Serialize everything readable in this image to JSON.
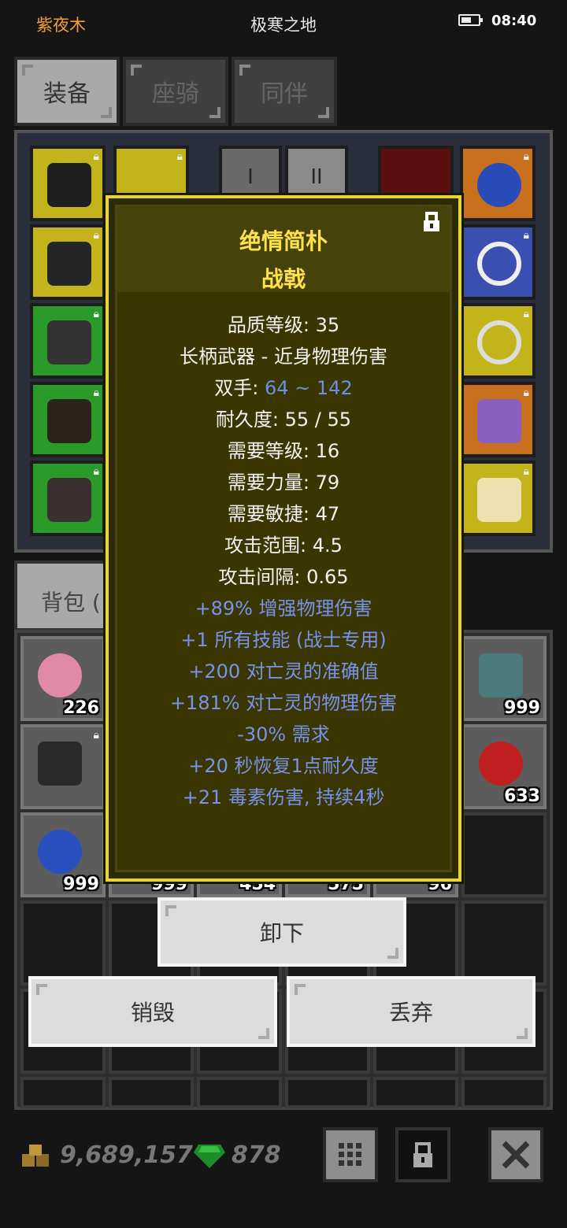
{
  "status": {
    "char_name": "紫夜木",
    "map_name": "极寒之地",
    "time": "08:40"
  },
  "tabs": [
    {
      "label": "装备"
    },
    {
      "label": "座骑"
    },
    {
      "label": "同伴"
    }
  ],
  "equip_pages": [
    "I",
    "II"
  ],
  "bag_tab": {
    "label": "背包 ("
  },
  "item": {
    "name": "绝情简朴",
    "type": "战戟",
    "lines": [
      {
        "text": "品质等级: 35",
        "style": "white"
      },
      {
        "text": "长柄武器 - 近身物理伤害",
        "style": "white"
      },
      {
        "label": "双手: ",
        "value": "64 ~ 142",
        "style": "mixed"
      },
      {
        "text": "耐久度: 55 / 55",
        "style": "white"
      },
      {
        "text": "需要等级: 16",
        "style": "white"
      },
      {
        "text": "需要力量: 79",
        "style": "white"
      },
      {
        "text": "需要敏捷: 47",
        "style": "white"
      },
      {
        "text": "攻击范围: 4.5",
        "style": "white"
      },
      {
        "text": "攻击间隔: 0.65",
        "style": "white"
      },
      {
        "text": "+89% 增强物理伤害",
        "style": "blue"
      },
      {
        "text": "+1 所有技能 (战士专用)",
        "style": "blue"
      },
      {
        "text": "+200 对亡灵的准确值",
        "style": "blue"
      },
      {
        "text": "+181% 对亡灵的物理伤害",
        "style": "blue"
      },
      {
        "text": "-30% 需求",
        "style": "blue"
      },
      {
        "text": "+20 秒恢复1点耐久度",
        "style": "blue"
      },
      {
        "text": "+21 毒素伤害, 持续4秒",
        "style": "blue"
      }
    ]
  },
  "bag_items": [
    {
      "qty": "226"
    },
    {
      "qty": "999"
    },
    {
      "qty": "633"
    },
    {
      "qty": "999"
    },
    {
      "qty": "999"
    },
    {
      "qty": "454"
    },
    {
      "qty": "575"
    },
    {
      "qty": "96"
    }
  ],
  "actions": {
    "unequip": "卸下",
    "destroy": "销毁",
    "discard": "丢弃"
  },
  "currency": {
    "gold": "9,689,157",
    "gems": "878"
  },
  "colors": {
    "accent_gold": "#f2a03a",
    "tooltip_border": "#e8d53a",
    "item_title": "#ffe14a",
    "magic_blue": "#7a92ec"
  },
  "icons": [
    "battery-icon",
    "lock-icon",
    "gold-coins-icon",
    "green-gem-icon",
    "grid-icon",
    "close-icon"
  ]
}
